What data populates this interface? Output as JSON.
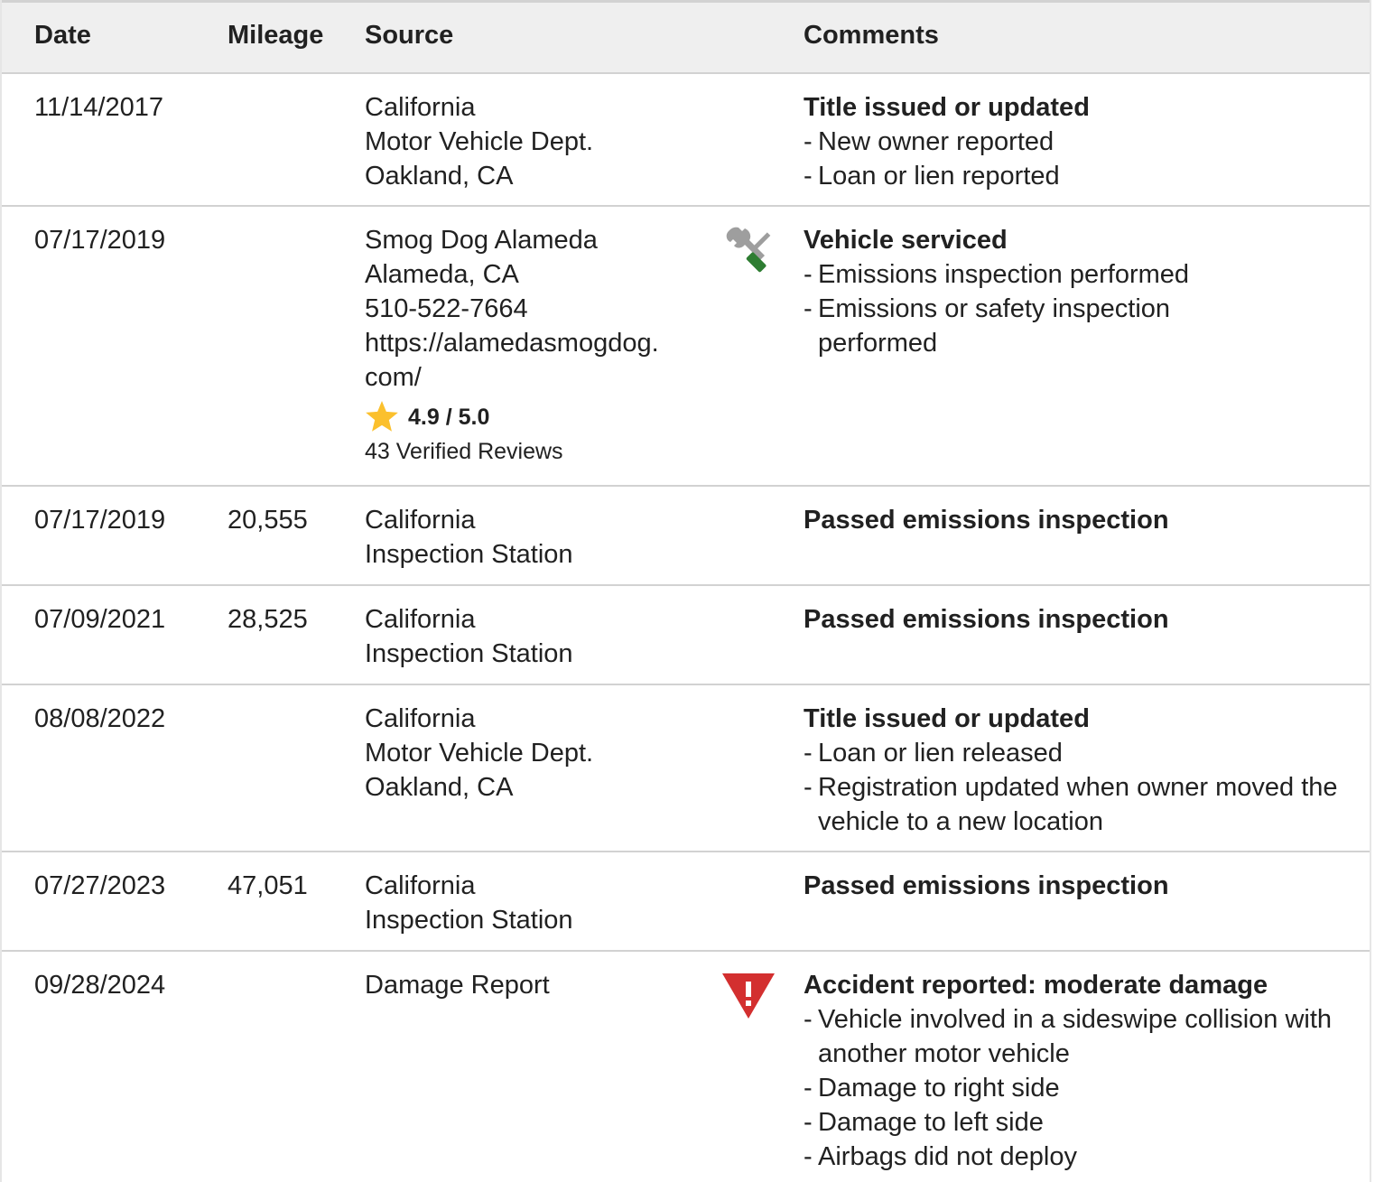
{
  "columns": {
    "date": "Date",
    "mileage": "Mileage",
    "source": "Source",
    "comments": "Comments"
  },
  "colors": {
    "header_bg": "#efefef",
    "border": "#d2d2d2",
    "star": "#fbc02d",
    "warning": "#d32f2f",
    "wrench_green": "#2e7d32"
  },
  "rows": [
    {
      "date": "11/14/2017",
      "mileage": "",
      "source": [
        "California",
        "Motor Vehicle Dept.",
        "Oakland, CA"
      ],
      "icon": "",
      "title": "Title issued or updated",
      "items": [
        "New owner reported",
        "Loan or lien reported"
      ]
    },
    {
      "date": "07/17/2019",
      "mileage": "",
      "source": [
        "Smog Dog Alameda",
        "Alameda, CA",
        "510-522-7664",
        "https://alamedasmogdog.",
        "com/"
      ],
      "rating": {
        "score": "4.9 / 5.0",
        "reviews": "43 Verified Reviews",
        "icon": "star-icon"
      },
      "icon": "wrench-screwdriver-icon",
      "title": "Vehicle serviced",
      "items": [
        "Emissions inspection performed",
        "Emissions or safety inspection performed"
      ]
    },
    {
      "date": "07/17/2019",
      "mileage": "20,555",
      "source": [
        "California",
        "Inspection Station"
      ],
      "icon": "",
      "title": "Passed emissions inspection",
      "items": []
    },
    {
      "date": "07/09/2021",
      "mileage": "28,525",
      "source": [
        "California",
        "Inspection Station"
      ],
      "icon": "",
      "title": "Passed emissions inspection",
      "items": []
    },
    {
      "date": "08/08/2022",
      "mileage": "",
      "source": [
        "California",
        "Motor Vehicle Dept.",
        "Oakland, CA"
      ],
      "icon": "",
      "title": "Title issued or updated",
      "items": [
        "Loan or lien released",
        "Registration updated when owner moved the vehicle to a new location"
      ]
    },
    {
      "date": "07/27/2023",
      "mileage": "47,051",
      "source": [
        "California",
        "Inspection Station"
      ],
      "icon": "",
      "title": "Passed emissions inspection",
      "items": []
    },
    {
      "date": "09/28/2024",
      "mileage": "",
      "source": [
        "Damage Report"
      ],
      "icon": "warning-triangle-icon",
      "title": "Accident reported: moderate damage",
      "items": [
        "Vehicle involved in a sideswipe collision with another motor vehicle",
        "Damage to right side",
        "Damage to left side",
        "Airbags did not deploy"
      ]
    }
  ]
}
